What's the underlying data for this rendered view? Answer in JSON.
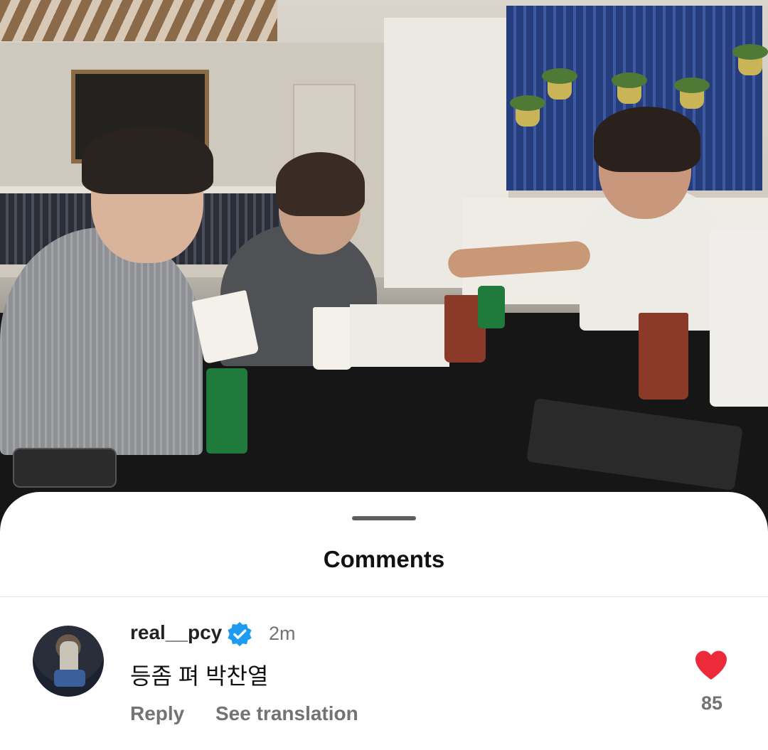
{
  "sheet": {
    "title": "Comments"
  },
  "comment": {
    "username": "real__pcy",
    "verified": true,
    "time": "2m",
    "text": "등좀 펴 박찬열",
    "reply_label": "Reply",
    "translate_label": "See translation",
    "like_count": "85",
    "liked": true
  },
  "icons": {
    "verified": "verified-badge-icon",
    "like": "heart-icon"
  },
  "colors": {
    "like": "#ed2a3a",
    "verified": "#1d9bf0",
    "secondary_text": "#737373"
  }
}
